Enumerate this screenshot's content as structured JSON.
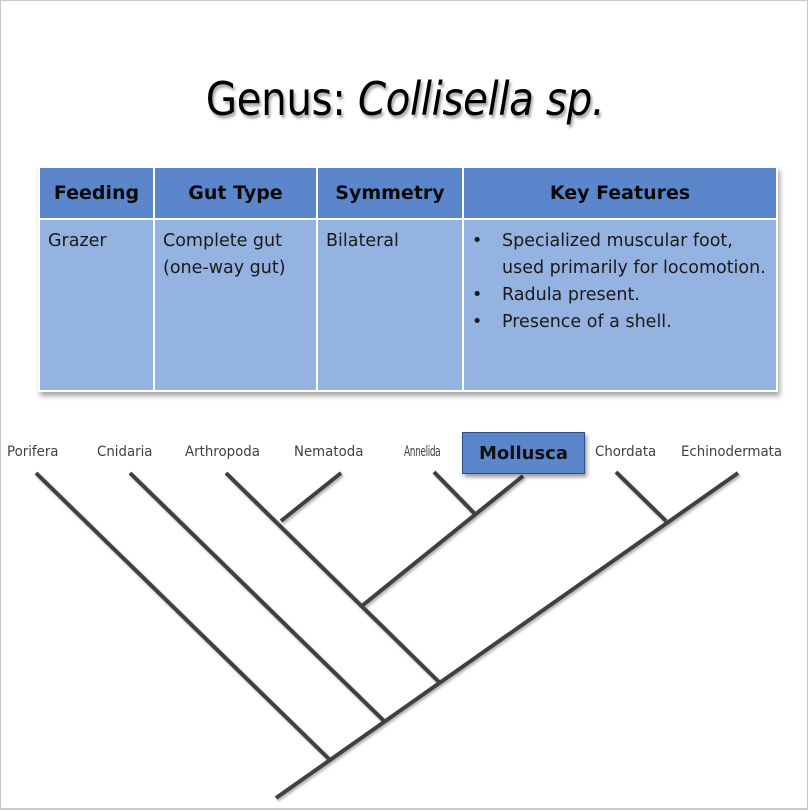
{
  "slide": {
    "title_prefix": "Genus: ",
    "title_italic": "Collisella sp."
  },
  "table": {
    "headers": [
      "Feeding",
      "Gut Type",
      "Symmetry",
      "Key Features"
    ],
    "row": {
      "feeding": "Grazer",
      "gut_type_line1": "Complete gut",
      "gut_type_line2": "(one-way gut)",
      "symmetry": "Bilateral",
      "key_features": [
        "Specialized muscular foot, used primarily for locomotion.",
        "Radula present.",
        "Presence of a shell."
      ]
    },
    "colors": {
      "header_bg": "#5b86cc",
      "cell_bg": "#95b3e0"
    }
  },
  "cladogram": {
    "taxa": [
      "Porifera",
      "Cnidaria",
      "Arthropoda",
      "Nematoda",
      "Annelida",
      "Mollusca",
      "Chordata",
      "Echinodermata"
    ],
    "highlighted": "Mollusca",
    "highlight_color": "#5b86cc",
    "line_color": "#404040",
    "groupings": [
      [
        "Nematoda",
        "Arthropoda"
      ],
      [
        "Annelida",
        "Mollusca"
      ],
      [
        "Chordata",
        "Echinodermata"
      ]
    ]
  }
}
